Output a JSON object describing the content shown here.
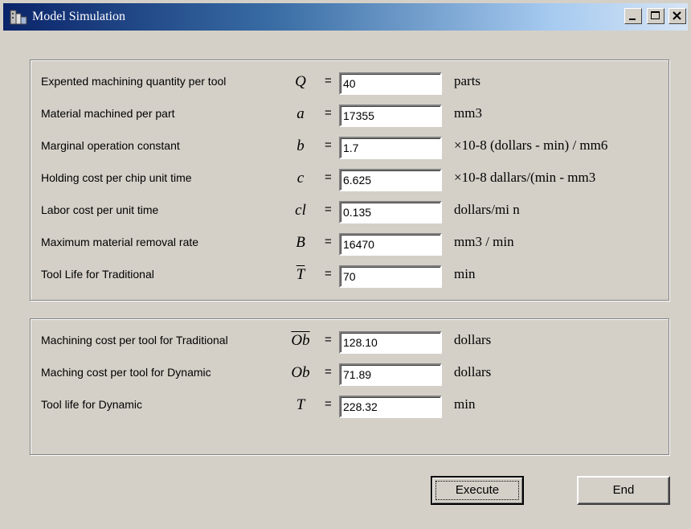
{
  "window": {
    "title": "Model Simulation",
    "icons": {
      "app": "app-icon",
      "minimize": "minimize-icon",
      "maximize": "maximize-icon",
      "close": "close-icon"
    }
  },
  "inputs": [
    {
      "label": "Expented machining quantity per tool",
      "symbol": "Q",
      "value": "40",
      "unit": "parts"
    },
    {
      "label": "Material machined per part",
      "symbol": "a",
      "value": "17355",
      "unit": "mm3"
    },
    {
      "label": "Marginal operation constant",
      "symbol": "b",
      "value": "1.7",
      "unit": "×10-8 (dollars - min) / mm6"
    },
    {
      "label": "Holding cost per chip unit time",
      "symbol": "c",
      "value": "6.625",
      "unit": "×10-8 dallars/(min - mm3"
    },
    {
      "label": "Labor cost per unit time",
      "symbol": "cl",
      "value": "0.135",
      "unit": "dollars/mi n"
    },
    {
      "label": "Maximum material removal rate",
      "symbol": "B",
      "value": "16470",
      "unit": "mm3 / min"
    },
    {
      "label": "Tool Life for Traditional",
      "symbol": "T",
      "value": "70",
      "unit": "min"
    }
  ],
  "outputs": [
    {
      "label": "Machining cost per tool for Traditional",
      "symbol": "Ob",
      "value": "128.10",
      "unit": "dollars"
    },
    {
      "label": "Maching cost per tool for Dynamic",
      "symbol": "Ob",
      "value": "71.89",
      "unit": "dollars"
    },
    {
      "label": "Tool life for Dynamic",
      "symbol": "T",
      "value": "228.32",
      "unit": "min"
    }
  ],
  "equals": "=",
  "buttons": {
    "execute": "Execute",
    "end": "End"
  },
  "colors": {
    "face": "#d4d0c8",
    "title_start": "#0a246a",
    "title_end": "#d6e4f4"
  }
}
